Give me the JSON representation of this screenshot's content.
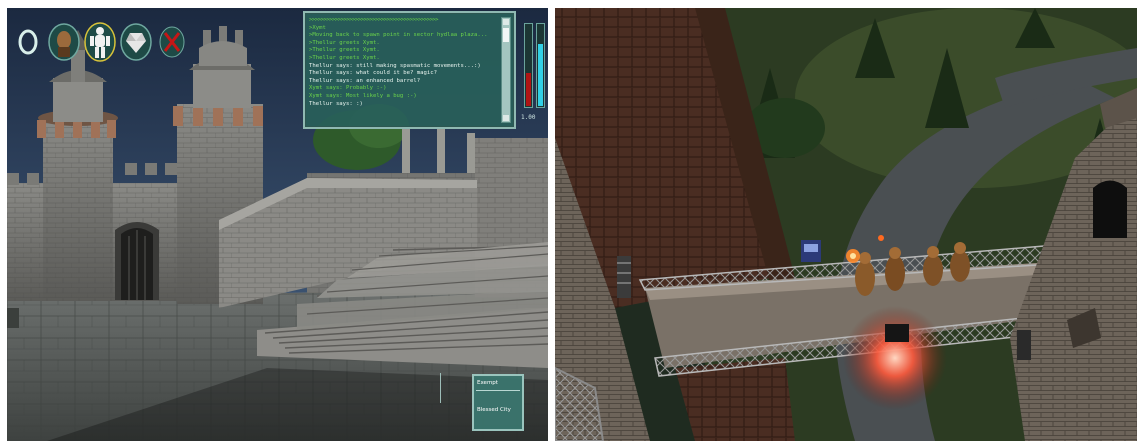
{
  "hud": {
    "icons": [
      {
        "name": "ring-icon"
      },
      {
        "name": "portrait-icon"
      },
      {
        "name": "character-figure-icon"
      },
      {
        "name": "gem-icon"
      },
      {
        "name": "crossed-swords-icon"
      }
    ]
  },
  "chat": {
    "lines": [
      {
        "kind": "sep",
        "text": ">>>>>>>>>>>>>>>>>>>>>>>>>>>>>>>>>>>>>>>>>>>>>"
      },
      {
        "kind": "system",
        "text": ">Xymt"
      },
      {
        "kind": "system",
        "text": ">Moving back to spawn point in sector hydlaa plaza..."
      },
      {
        "kind": "system",
        "text": ">Thellur greets Xymt."
      },
      {
        "kind": "system",
        "text": ">Thellur greets Xymt."
      },
      {
        "kind": "system",
        "text": ">Thellur greets Xymt."
      },
      {
        "kind": "say",
        "text": "Thellur says: still making spasmatic movements...:)"
      },
      {
        "kind": "say",
        "text": "Thellur says: what could it be? magic?"
      },
      {
        "kind": "say",
        "text": "Thellur says: an enhanced barrel?"
      },
      {
        "kind": "system",
        "text": "Xymt says: Probably :-)"
      },
      {
        "kind": "system",
        "text": "Xymt says: Most likely a bug :-)"
      },
      {
        "kind": "say",
        "text": "Thellur says: :)"
      }
    ]
  },
  "gauges": {
    "readout": "1.00",
    "health_level": 0.4,
    "mana_level": 0.75,
    "health_color": "#b01515",
    "mana_color": "#32d0e6"
  },
  "actions": {
    "top_label": "Exempt",
    "bottom_label": "Blessed City"
  },
  "colors": {
    "panel_bg": "#285f5a",
    "panel_border": "#8fb9b2",
    "chat_system": "#6bd44a",
    "chat_say": "#e8f4ef"
  }
}
